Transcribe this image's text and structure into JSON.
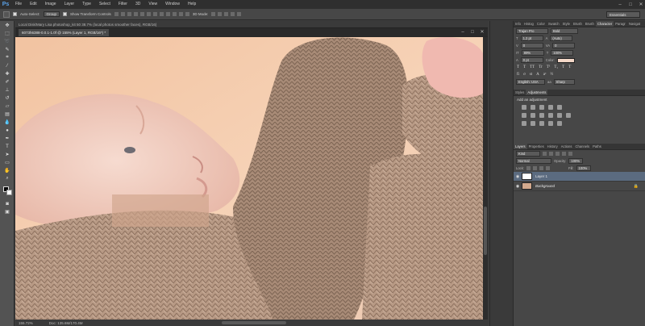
{
  "app": {
    "logo": "Ps",
    "menu": [
      "File",
      "Edit",
      "Image",
      "Layer",
      "Type",
      "Select",
      "Filter",
      "3D",
      "View",
      "Window",
      "Help"
    ],
    "window_controls": [
      "–",
      "□",
      "✕"
    ]
  },
  "options_bar": {
    "auto_select_label": "Auto-Select:",
    "auto_select_value": "Group",
    "transform_label": "Show Transform Controls",
    "mode_label": "3D Mode:",
    "workspace": "Essentials"
  },
  "document": {
    "tab_label": "6073h6388-0.0.1-1.0f @ 155% (Layer 1, RGB/16*) *",
    "title_path": "Local Disk/Mary Lisa photoshop_kit 50 38.7% (local photos smoother faces), RGB/16)",
    "zoom": "155.72%",
    "doc_size": "Doc: 135.6M/170.4M"
  },
  "character_panel": {
    "tabs": [
      "Info",
      "Histog",
      "Color",
      "Swatch",
      "Style",
      "Brush",
      "Brush",
      "Character",
      "Paragr",
      "Navigat"
    ],
    "active_tab": "Character",
    "font_family": "Trajan Pro",
    "font_style": "Bold",
    "size": "1.2 pt",
    "leading": "(Auto)",
    "kerning": "0",
    "tracking": "0",
    "vscale": "89%",
    "hscale": "100%",
    "baseline": "0 pt",
    "color_label": "Color:",
    "language": "English: USA",
    "anti_alias": "Sharp",
    "type_buttons": [
      "T",
      "T",
      "TT",
      "Tr",
      "T¹",
      "T₁",
      "T",
      "T"
    ]
  },
  "adjustments_panel": {
    "tabs": [
      "Styles",
      "Adjustments"
    ],
    "active_tab": "Adjustments",
    "title": "Add an adjustment"
  },
  "layers_panel": {
    "tabs": [
      "Layers",
      "Properties",
      "History",
      "Actions",
      "Channels",
      "Paths"
    ],
    "active_tab": "Layers",
    "kind_filter": "Kind",
    "blend_mode": "Normal",
    "opacity_label": "Opacity:",
    "opacity": "100%",
    "lock_label": "Lock:",
    "fill_label": "Fill:",
    "fill": "100%",
    "layers": [
      {
        "name": "Layer 1",
        "selected": true
      },
      {
        "name": "Background",
        "selected": false,
        "locked": true
      }
    ]
  },
  "colors": {
    "foreground": "#000000",
    "background": "#ffffff",
    "selection": "#5b6b80"
  }
}
